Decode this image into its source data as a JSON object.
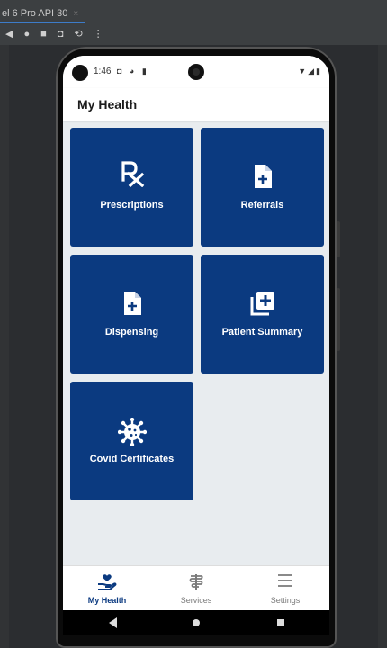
{
  "emulator": {
    "tab_title": "el 6 Pro API 30",
    "tab_close": "×",
    "tools": [
      "◀",
      "●",
      "■",
      "◘",
      "⟲",
      "⋮"
    ]
  },
  "status_bar": {
    "time": "1:46",
    "left_icons": "◘ ◕ ▮",
    "right_icons": "▼◢▮"
  },
  "app_bar": {
    "title": "My Health"
  },
  "tiles": [
    {
      "label": "Prescriptions",
      "icon": "rx-icon"
    },
    {
      "label": "Referrals",
      "icon": "document-plus-icon"
    },
    {
      "label": "Dispensing",
      "icon": "document-plus-icon"
    },
    {
      "label": "Patient Summary",
      "icon": "library-add-icon"
    },
    {
      "label": "Covid Certificates",
      "icon": "virus-icon"
    }
  ],
  "bottom_nav": [
    {
      "label": "My Health",
      "icon": "hand-heart-icon",
      "active": true
    },
    {
      "label": "Services",
      "icon": "medical-services-icon",
      "active": false
    },
    {
      "label": "Settings",
      "icon": "menu-icon",
      "active": false
    }
  ],
  "colors": {
    "tile": "#0b3a80",
    "active": "#0b3a80",
    "inactive": "#7a7a7a",
    "background": "#e8ecef"
  }
}
